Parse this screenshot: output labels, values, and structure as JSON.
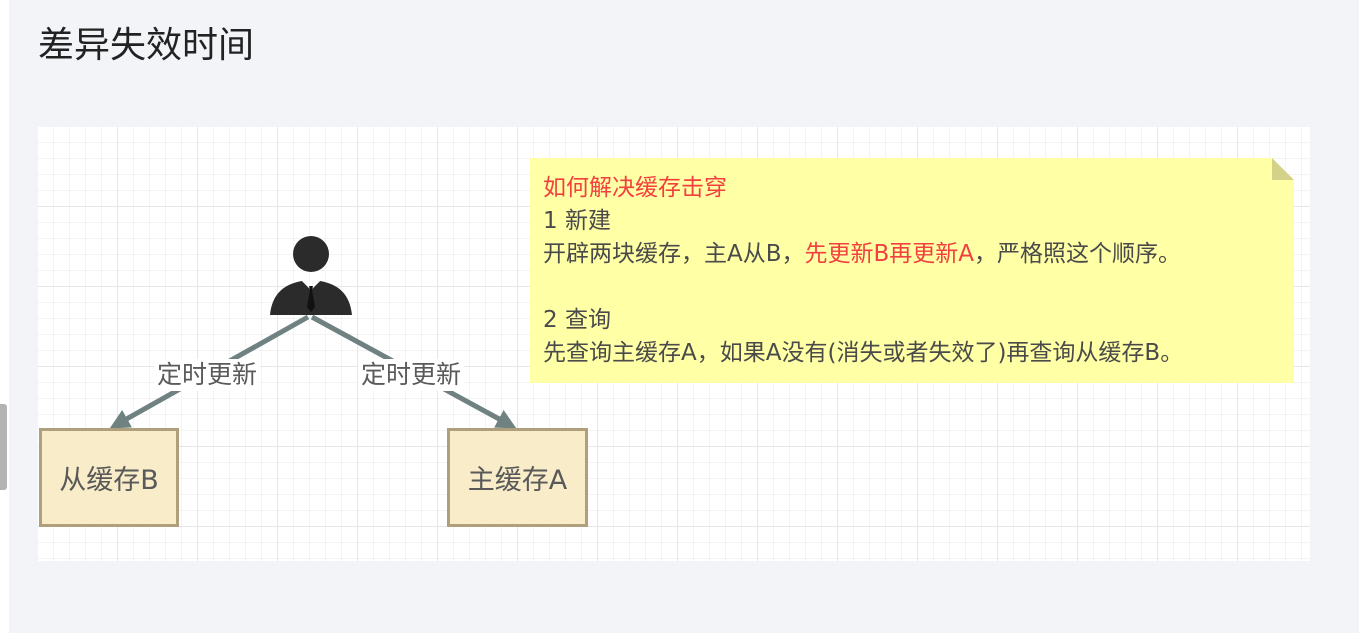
{
  "page": {
    "title": "差异失效时间"
  },
  "diagram": {
    "edge_labels": {
      "left": "定时更新",
      "right": "定时更新"
    },
    "nodes": {
      "slave_cache": "从缓存B",
      "master_cache": "主缓存A"
    },
    "note": {
      "heading": "如何解决缓存击穿",
      "step1_title": "1 新建",
      "step1_text_part1": "开辟两块缓存，主A从B，",
      "step1_text_highlight": "先更新B再更新A",
      "step1_text_part2": "，严格照这个顺序。",
      "step2_title": "2 查询",
      "step2_text": "先查询主缓存A，如果A没有(消失或者失效了)再查询从缓存B。"
    },
    "icons": {
      "actor": "person-icon"
    },
    "colors": {
      "note_background": "#ffffa6",
      "note_highlight": "#f23f3f",
      "node_fill": "#f8ecc9",
      "node_border": "#b09f7c",
      "edge": "#6f8181"
    }
  }
}
